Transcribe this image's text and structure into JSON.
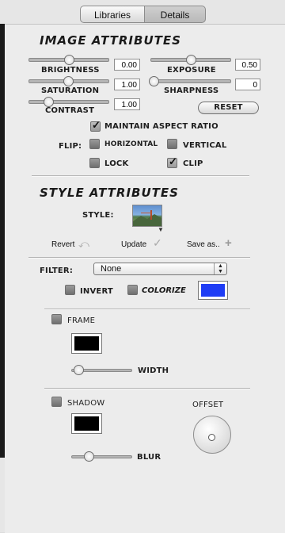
{
  "tabs": {
    "libraries": "Libraries",
    "details": "Details"
  },
  "image_attributes": {
    "heading": "IMAGE ATTRIBUTES",
    "brightness": {
      "label": "BRIGHTNESS",
      "value": "0.00"
    },
    "saturation": {
      "label": "SATURATION",
      "value": "1.00"
    },
    "contrast": {
      "label": "CONTRAST",
      "value": "1.00"
    },
    "exposure": {
      "label": "EXPOSURE",
      "value": "0.50"
    },
    "sharpness": {
      "label": "SHARPNESS",
      "value": "0"
    },
    "reset_label": "RESET",
    "maintain_aspect_ratio": {
      "label": "MAINTAIN ASPECT RATIO",
      "checked": true
    },
    "flip_label": "FLIP:",
    "horizontal": {
      "label": "HORIZONTAL",
      "checked": false
    },
    "vertical": {
      "label": "VERTICAL",
      "checked": false
    },
    "lock": {
      "label": "LOCK",
      "checked": false
    },
    "clip": {
      "label": "CLIP",
      "checked": true
    }
  },
  "style_attributes": {
    "heading": "STYLE ATTRIBUTES",
    "style_label": "STYLE:",
    "revert_label": "Revert",
    "update_label": "Update",
    "save_as_label": "Save as.."
  },
  "filter": {
    "label": "FILTER:",
    "selected": "None",
    "invert": {
      "label": "INVERT",
      "checked": false
    },
    "colorize": {
      "label": "COLORIZE",
      "checked": false
    },
    "color": "#1f3df5"
  },
  "frame": {
    "label": "FRAME",
    "checked": false,
    "color": "#000000",
    "width_label": "WIDTH"
  },
  "shadow": {
    "label": "SHADOW",
    "checked": false,
    "color": "#000000",
    "blur_label": "BLUR",
    "offset_label": "OFFSET"
  }
}
